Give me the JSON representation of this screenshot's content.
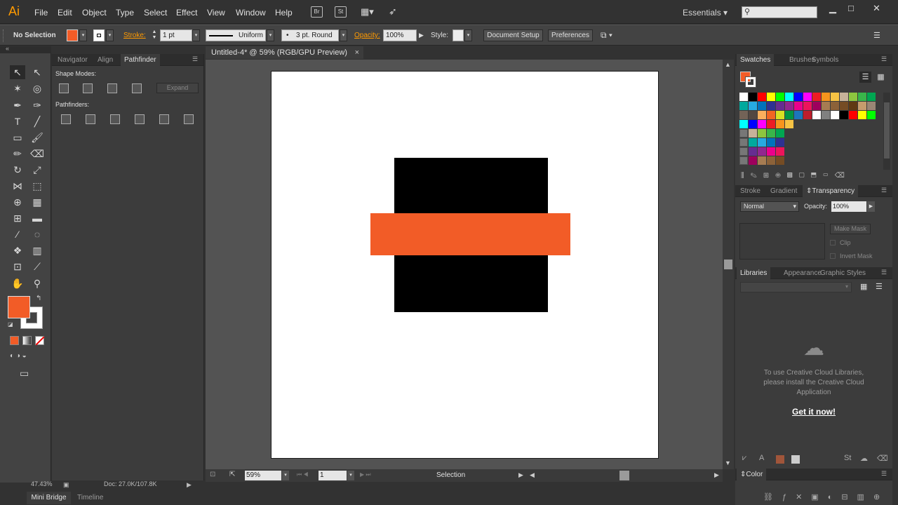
{
  "app": {
    "logo": "Ai"
  },
  "menu": [
    "File",
    "Edit",
    "Object",
    "Type",
    "Select",
    "Effect",
    "View",
    "Window",
    "Help"
  ],
  "menu_icons": [
    "Br",
    "St"
  ],
  "workspace": "Essentials",
  "control_bar": {
    "selection_label": "No Selection",
    "stroke_label": "Stroke:",
    "stroke_weight": "1 pt",
    "stroke_profile": "Uniform",
    "brush": "3 pt. Round",
    "opacity_label": "Opacity:",
    "opacity_value": "100%",
    "style_label": "Style:",
    "doc_setup_button": "Document Setup",
    "preferences_button": "Preferences"
  },
  "pathfinder_panel": {
    "tabs": [
      "Navigator",
      "Align",
      "Pathfinder"
    ],
    "active_tab": "Pathfinder",
    "shape_modes_label": "Shape Modes:",
    "pathfinders_label": "Pathfinders:",
    "expand_button": "Expand"
  },
  "document": {
    "tab_title": "Untitled-4* @ 59% (RGB/GPU Preview)"
  },
  "status": {
    "zoom": "59%",
    "artboard_number": "1",
    "current_tool": "Selection",
    "zoom_info": "47.43%",
    "doc_info": "Doc: 27.0K/107.8K"
  },
  "bottom_tabs": [
    "Mini Bridge",
    "Timeline"
  ],
  "swatches_panel": {
    "tabs": [
      "Swatches",
      "Brushes",
      "Symbols"
    ]
  },
  "transparency_panel": {
    "tabs": [
      "Stroke",
      "Gradient",
      "Transparency"
    ],
    "blend_mode": "Normal",
    "opacity_label": "Opacity:",
    "opacity_value": "100%",
    "make_mask_button": "Make Mask",
    "clip_label": "Clip",
    "invert_mask_label": "Invert Mask"
  },
  "libraries_panel": {
    "tabs": [
      "Libraries",
      "Appearance",
      "Graphic Styles"
    ],
    "message": "To use Creative Cloud Libraries, please install the Creative Cloud Application",
    "cta": "Get it now!"
  },
  "color_panel": {
    "title": "Color"
  },
  "colors": {
    "fill": "#f25c27",
    "artboard": "#ffffff",
    "shape_black": "#000000",
    "shape_orange": "#f25c27",
    "accent_orange": "#ff9a00"
  }
}
